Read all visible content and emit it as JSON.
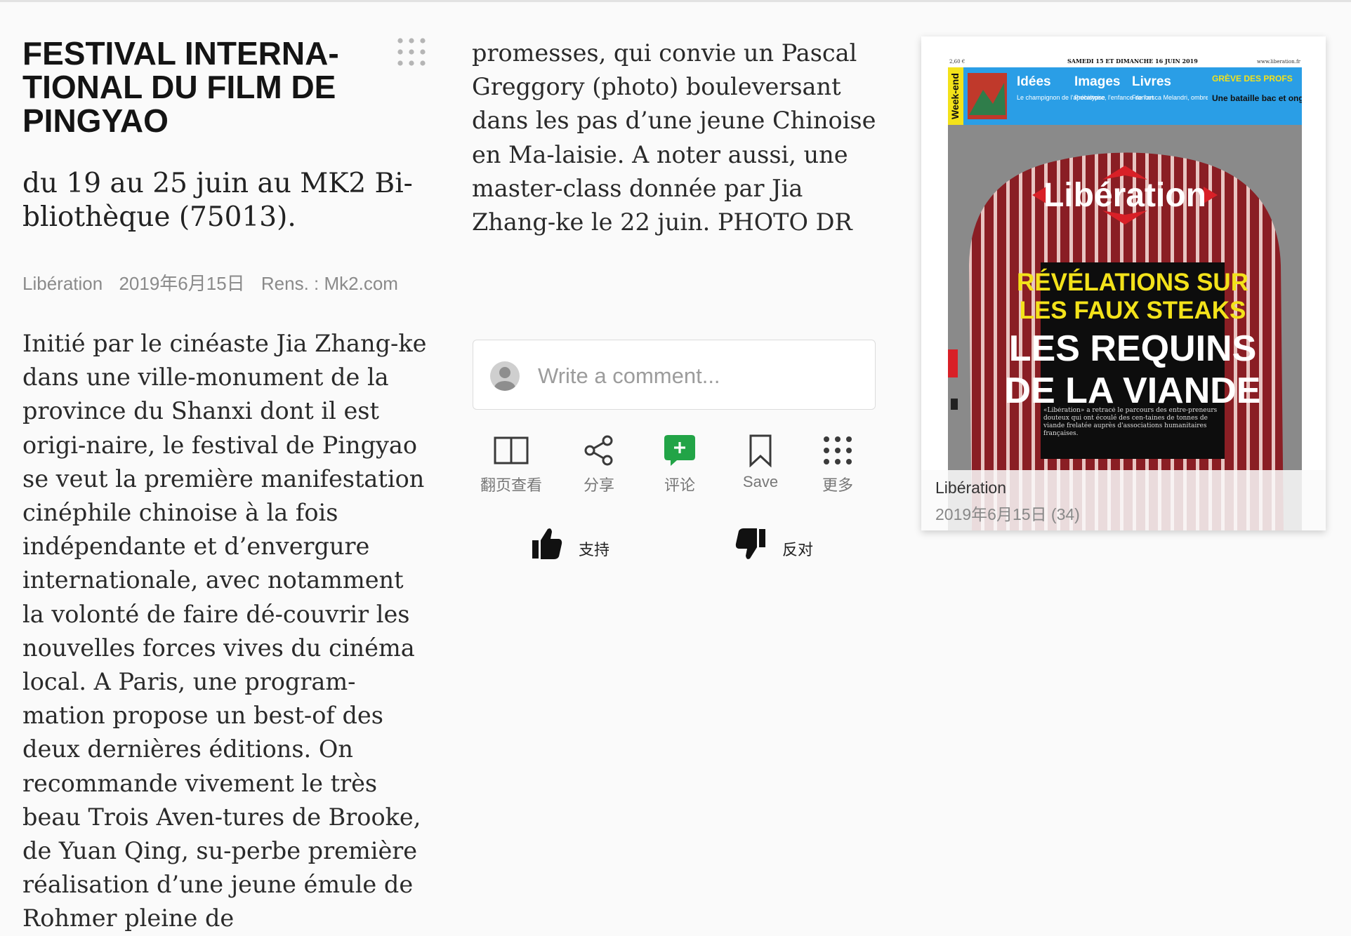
{
  "article": {
    "title": "FESTIVAL INTERNA-TIONAL DU FILM DE PINGYAO",
    "subtitle": "du 19 au 25 juin au MK2 Bi-bliothèque (75013).",
    "meta": {
      "source": "Libération",
      "date": "2019年6月15日",
      "rens": "Rens. : Mk2.com"
    },
    "body_left": "Initié par le cinéaste Jia Zhang-ke dans une ville-monument de la province du Shanxi dont il est origi-naire, le festival de Pingyao se veut la première manifestation cinéphile chinoise à la fois indépendante et d’envergure internationale, avec notamment la volonté de faire dé-couvrir les nouvelles forces vives du cinéma local. A Paris, une program-mation propose un best-of des deux dernières éditions. On recommande vivement le très beau Trois Aven-tures de Brooke, de Yuan Qing, su-perbe première réalisation d’une jeune émule de Rohmer pleine de",
    "body_mid": "promesses, qui convie un Pascal Greggory (photo) bouleversant dans les pas d’une jeune Chinoise en Ma-laisie. A noter aussi, une master-class donnée par Jia Zhang-ke le 22 juin. PHOTO DR"
  },
  "comment": {
    "placeholder": "Write a comment..."
  },
  "actions": [
    {
      "label": "翻页查看",
      "icon": "book-icon"
    },
    {
      "label": "分享",
      "icon": "share-icon"
    },
    {
      "label": "评论",
      "icon": "comment-icon",
      "color": "#22a447"
    },
    {
      "label": "Save",
      "icon": "bookmark-icon"
    },
    {
      "label": "更多",
      "icon": "more-icon"
    }
  ],
  "votes": {
    "support": "支持",
    "oppose": "反对"
  },
  "newspaper": {
    "source": "Libération",
    "date": "2019年6月15日 (34)",
    "cover": {
      "dateline": "SAMEDI 15 ET DIMANCHE 16 JUIN 2019",
      "website": "www.liberation.fr",
      "price": "2,60 €",
      "weekend": "Week-end",
      "teasers": [
        {
          "head": "Idées",
          "text": "Le champignon de l'apocalypse"
        },
        {
          "head": "Images",
          "text": "Préhistoire, l'enfance de l'art"
        },
        {
          "head": "Livres",
          "text": "Francesca Melandri, ombres italiennes"
        }
      ],
      "strike_head": "GRÈVE DES PROFS",
      "strike_text": "Une bataille bac et ongles",
      "masthead": "Libération",
      "headline_yellow": [
        "RÉVÉLATIONS SUR",
        "LES FAUX STEAKS"
      ],
      "headline_white": [
        "LES REQUINS",
        "DE LA VIANDE"
      ],
      "deck": "«Libération» a retracé le parcours des entre-preneurs douteux qui ont écoulé des cen-taines de tonnes de viande frelatée auprès d'associations humanitaires françaises.",
      "colors": {
        "blue": "#2a9ee6",
        "yellow": "#f3e21a",
        "red": "#d82027",
        "meat": "#8a1e24"
      }
    }
  }
}
